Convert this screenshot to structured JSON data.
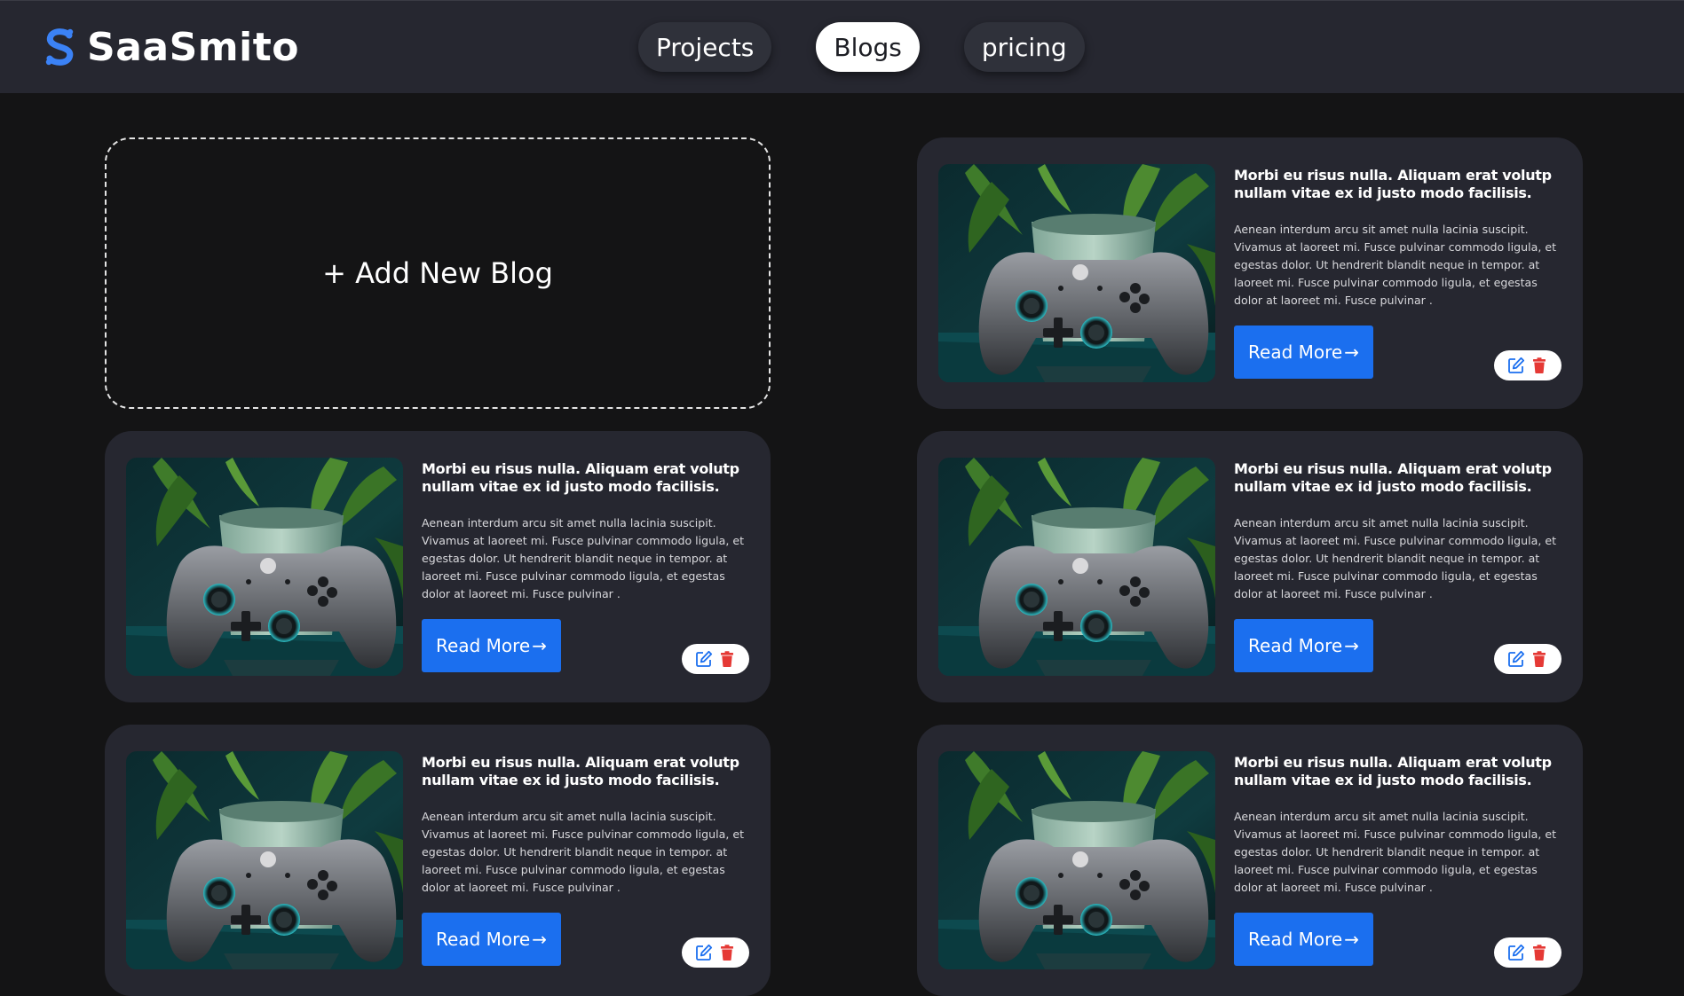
{
  "brand": {
    "name": "SaaSmito",
    "logo_icon": "s-logo-icon",
    "logo_color": "#3b82f6"
  },
  "nav": {
    "items": [
      {
        "label": "Projects",
        "active": false
      },
      {
        "label": "Blogs",
        "active": true
      },
      {
        "label": "pricing",
        "active": false
      }
    ]
  },
  "add_blog": {
    "label": "+ Add New Blog"
  },
  "blogs": [
    {
      "title": "Morbi eu risus nulla. Aliquam erat volutp nullam vitae ex id justo modo facilisis.",
      "excerpt": "Aenean interdum arcu sit amet nulla lacinia suscipit. Vivamus at laoreet mi. Fusce pulvinar commodo ligula, et egestas dolor. Ut hendrerit blandit neque in tempor. at laoreet mi. Fusce pulvinar commodo ligula, et egestas dolor at laoreet mi. Fusce pulvinar .",
      "read_more": "Read More",
      "image": "game-controller-plant-photo"
    },
    {
      "title": "Morbi eu risus nulla. Aliquam erat volutp nullam vitae ex id justo modo facilisis.",
      "excerpt": "Aenean interdum arcu sit amet nulla lacinia suscipit. Vivamus at laoreet mi. Fusce pulvinar commodo ligula, et egestas dolor. Ut hendrerit blandit neque in tempor. at laoreet mi. Fusce pulvinar commodo ligula, et egestas dolor at laoreet mi. Fusce pulvinar .",
      "read_more": "Read More",
      "image": "game-controller-plant-photo"
    },
    {
      "title": "Morbi eu risus nulla. Aliquam erat volutp nullam vitae ex id justo modo facilisis.",
      "excerpt": "Aenean interdum arcu sit amet nulla lacinia suscipit. Vivamus at laoreet mi. Fusce pulvinar commodo ligula, et egestas dolor. Ut hendrerit blandit neque in tempor. at laoreet mi. Fusce pulvinar commodo ligula, et egestas dolor at laoreet mi. Fusce pulvinar .",
      "read_more": "Read More",
      "image": "game-controller-plant-photo"
    },
    {
      "title": "Morbi eu risus nulla. Aliquam erat volutp nullam vitae ex id justo modo facilisis.",
      "excerpt": "Aenean interdum arcu sit amet nulla lacinia suscipit. Vivamus at laoreet mi. Fusce pulvinar commodo ligula, et egestas dolor. Ut hendrerit blandit neque in tempor. at laoreet mi. Fusce pulvinar commodo ligula, et egestas dolor at laoreet mi. Fusce pulvinar .",
      "read_more": "Read More",
      "image": "game-controller-plant-photo"
    },
    {
      "title": "Morbi eu risus nulla. Aliquam erat volutp nullam vitae ex id justo modo facilisis.",
      "excerpt": "Aenean interdum arcu sit amet nulla lacinia suscipit. Vivamus at laoreet mi. Fusce pulvinar commodo ligula, et egestas dolor. Ut hendrerit blandit neque in tempor. at laoreet mi. Fusce pulvinar commodo ligula, et egestas dolor at laoreet mi. Fusce pulvinar .",
      "read_more": "Read More",
      "image": "game-controller-plant-photo"
    }
  ],
  "actions": {
    "edit_icon": "edit-icon",
    "delete_icon": "trash-icon",
    "edit_color": "#1b6fef",
    "delete_color": "#e53935"
  },
  "colors": {
    "accent": "#1b6fef",
    "page_bg": "#141415",
    "card_bg": "#262730",
    "header_bg": "#262730"
  }
}
